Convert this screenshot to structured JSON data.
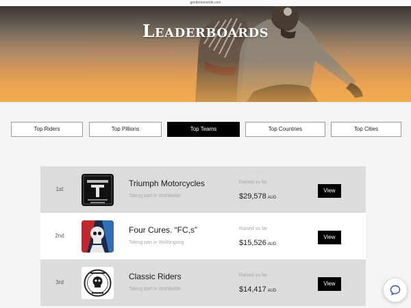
{
  "url_bar": {
    "text": "gentlemansride.com"
  },
  "hero": {
    "title": "Leaderboards"
  },
  "tabs": [
    {
      "label": "Top Riders"
    },
    {
      "label": "Top Pillions"
    },
    {
      "label": "Top Teams"
    },
    {
      "label": "Top Countries"
    },
    {
      "label": "Top Cities"
    }
  ],
  "active_tab": "Top Teams",
  "leaderboard": {
    "raised_label": "Raised so far",
    "view_label": "View",
    "rows": [
      {
        "rank": "1st",
        "name": "Triumph Motorcycles",
        "location": "Taking part in Worldwide",
        "amount": "$29,578",
        "currency": "AUD",
        "logo_icon": "triumph-logo-icon"
      },
      {
        "rank": "2nd",
        "name": "Four Cures. “FC,s”",
        "location": "Taking part in Wollongong",
        "amount": "$15,526",
        "currency": "AUD",
        "logo_icon": "skull-logo-icon"
      },
      {
        "rank": "3rd",
        "name": "Classic Riders",
        "location": "Taking part in Worldwide",
        "amount": "$14,417",
        "currency": "AUD",
        "logo_icon": "classic-riders-logo-icon"
      }
    ]
  },
  "colors": {
    "active_tab_bg": "#000000",
    "row_grey": "#dcdcdc",
    "hero_orange": "#f0a74d"
  },
  "chat": {
    "icon": "chat-bubble-icon"
  }
}
